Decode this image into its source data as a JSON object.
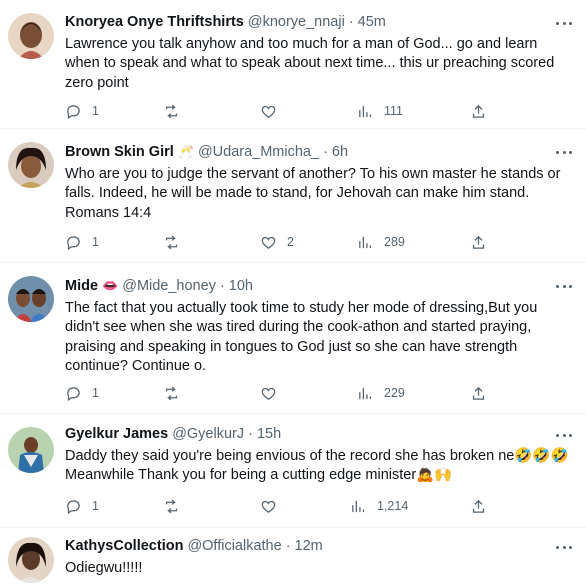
{
  "tweets": [
    {
      "name": "Knoryea Onye Thriftshirts",
      "handle": "@knorye_nnaji",
      "separator": "·",
      "time": "45m",
      "text": "Lawrence you talk anyhow and too much for a man of God... go and learn when to speak and what to speak about next time... this ur preaching scored zero point",
      "replies": "1",
      "retweets": "",
      "likes": "",
      "views": "111",
      "avatar_color": "#c9a27e",
      "name_emoji": ""
    },
    {
      "name": "Brown Skin Girl",
      "handle": "@Udara_Mmicha_",
      "separator": "·",
      "time": "6h",
      "text": "Who are you to judge the servant of another? To his own master he stands or falls. Indeed, he will be made to stand, for Jehovah can make him stand. Romans 14:4",
      "replies": "1",
      "retweets": "",
      "likes": "2",
      "views": "289",
      "avatar_color": "#8a5a3c",
      "name_emoji": "🥂"
    },
    {
      "name": "Mide",
      "handle": "@Mide_honey",
      "separator": "·",
      "time": "10h",
      "text": "The fact that you actually took time to study her mode of dressing,But you didn't see when she was tired during the cook-athon and started praying, praising and speaking in tongues to God just so she can have strength continue? Continue o.",
      "replies": "1",
      "retweets": "",
      "likes": "",
      "views": "229",
      "avatar_color": "#4a6b8a",
      "name_emoji": "👄"
    },
    {
      "name": "Gyelkur James",
      "handle": "@GyelkurJ",
      "separator": "·",
      "time": "15h",
      "text": "Daddy they said you're being envious of the record she has broken ne🤣🤣🤣 Meanwhile Thank you for being a cutting edge minister🙇🙌",
      "replies": "1",
      "retweets": "",
      "likes": "",
      "views": "1,214",
      "avatar_color": "#7fae7a",
      "name_emoji": ""
    },
    {
      "name": "KathysCollection",
      "handle": "@Officialkathe",
      "separator": "·",
      "time": "12m",
      "text": "Odiegwu!!!!!",
      "replies": "",
      "retweets": "",
      "likes": "",
      "views": "",
      "avatar_color": "#5c3b2a",
      "name_emoji": ""
    }
  ],
  "icons": {
    "reply": "reply-icon",
    "retweet": "retweet-icon",
    "like": "heart-icon",
    "views": "views-icon",
    "share": "share-icon",
    "more": "more-icon"
  }
}
